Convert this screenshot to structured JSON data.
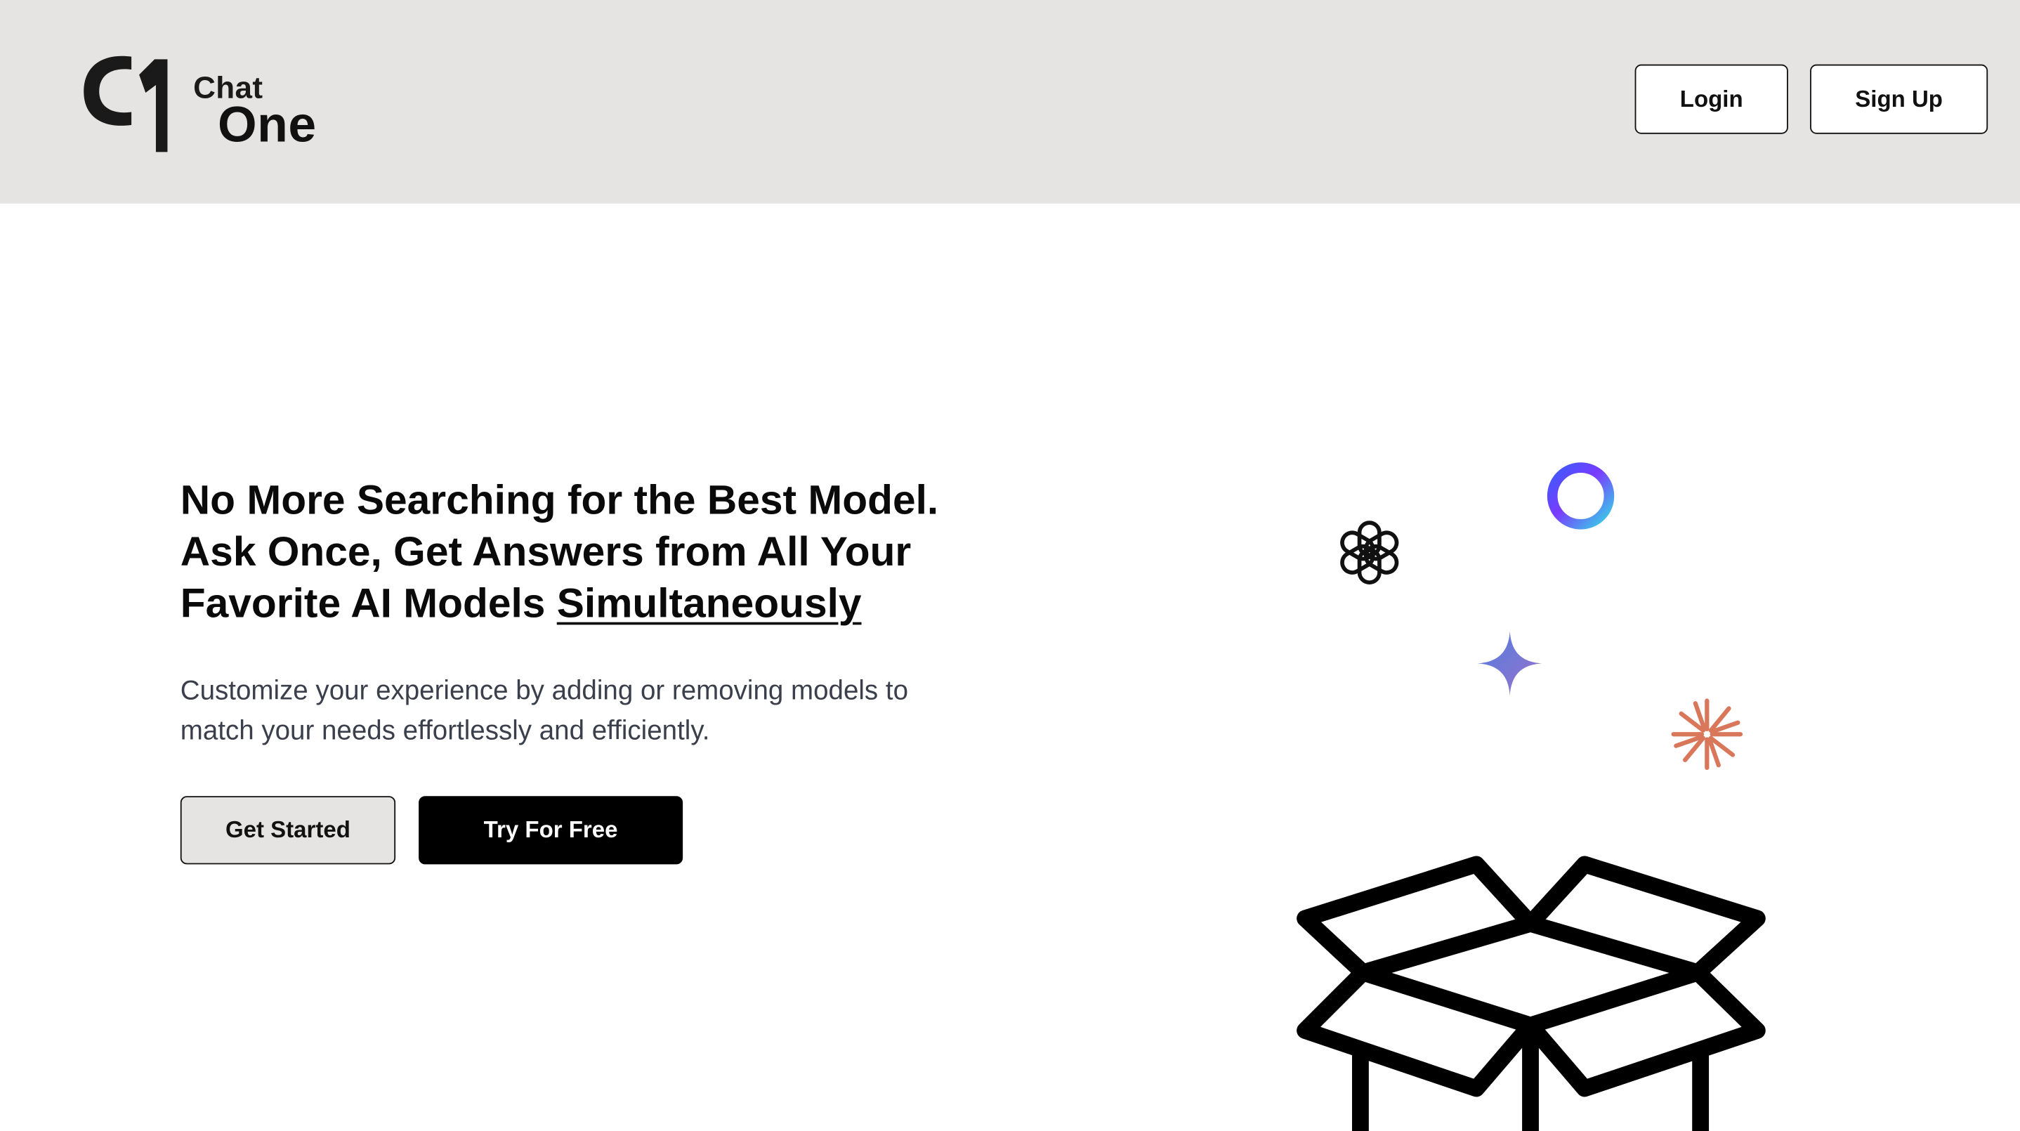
{
  "header": {
    "logo": {
      "line1": "Chat",
      "line2": "One"
    },
    "login_label": "Login",
    "signup_label": "Sign Up"
  },
  "hero": {
    "title_line1": "No More Searching for the Best Model.",
    "title_line2": "Ask Once, Get Answers from All Your",
    "title_line3_prefix": "Favorite AI Models ",
    "title_line3_emphasis": "Simultaneously",
    "subtitle_line1": "Customize your experience by adding or removing models to",
    "subtitle_line2": "match your needs effortlessly and efficiently.",
    "get_started_label": "Get Started",
    "try_free_label": "Try For Free"
  },
  "illustration": {
    "icons": [
      "openai-icon",
      "ring-icon",
      "sparkle-icon",
      "asterisk-icon",
      "open-box-icon"
    ],
    "colors": {
      "header_bg": "#e5e4e2",
      "asterisk": "#d9775b",
      "sparkle_start": "#4f7de0",
      "sparkle_end": "#9b72cb",
      "ring_start": "#3b5bff",
      "ring_end": "#35d6e6"
    }
  }
}
